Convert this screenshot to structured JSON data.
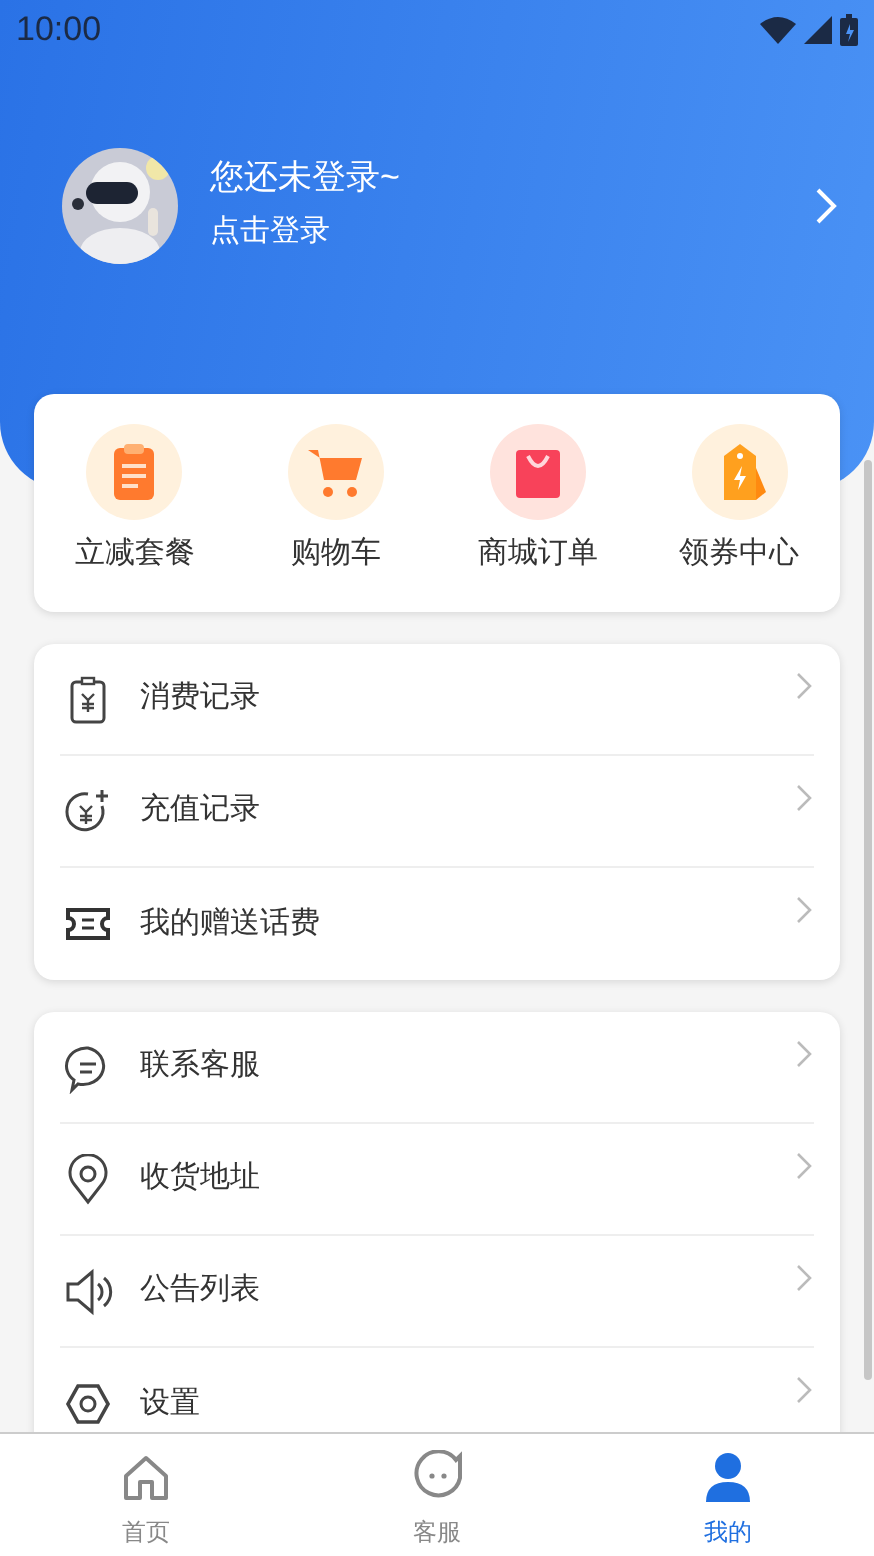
{
  "status_bar": {
    "time": "10:00"
  },
  "profile": {
    "title": "您还未登录~",
    "subtitle": "点击登录"
  },
  "shortcuts": [
    {
      "label": "立减套餐"
    },
    {
      "label": "购物车"
    },
    {
      "label": "商城订单"
    },
    {
      "label": "领券中心"
    }
  ],
  "menu_groups": [
    {
      "items": [
        {
          "label": "消费记录"
        },
        {
          "label": "充值记录"
        },
        {
          "label": "我的赠送话费"
        }
      ]
    },
    {
      "items": [
        {
          "label": "联系客服"
        },
        {
          "label": "收货地址"
        },
        {
          "label": "公告列表"
        },
        {
          "label": "设置"
        }
      ]
    }
  ],
  "tab_bar": [
    {
      "label": "首页",
      "selected": false
    },
    {
      "label": "客服",
      "selected": false
    },
    {
      "label": "我的",
      "selected": true
    }
  ]
}
